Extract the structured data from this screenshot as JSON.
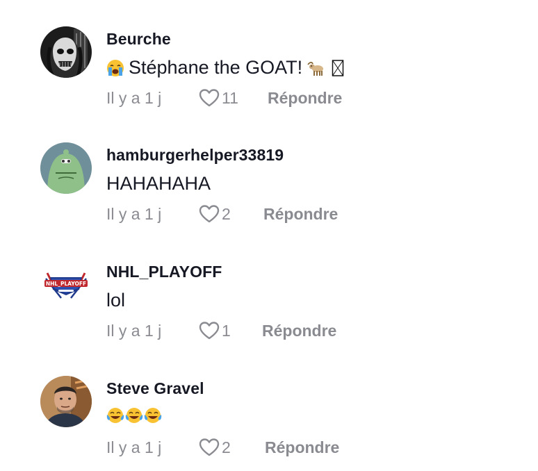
{
  "comments": [
    {
      "username": "Beurche",
      "text": "Stéphane the GOAT!",
      "timestamp": "Il y a 1 j",
      "likes": "11",
      "reply_label": "Répondre",
      "emojis_before": [
        "loudly-crying-face-emoji"
      ],
      "emojis_after": [
        "goat-emoji",
        "missing-glyph"
      ]
    },
    {
      "username": "hamburgerhelper33819",
      "text": "HAHAHAHA",
      "timestamp": "Il y a 1 j",
      "likes": "2",
      "reply_label": "Répondre"
    },
    {
      "username": "NHL_PLAYOFF",
      "text": "lol",
      "timestamp": "Il y a 1 j",
      "likes": "1",
      "reply_label": "Répondre",
      "avatar_logo_text": "NHL_PLAYOFF"
    },
    {
      "username": "Steve Gravel",
      "text": "",
      "timestamp": "Il y a 1 j",
      "likes": "2",
      "reply_label": "Répondre",
      "emojis_only": [
        "tears-of-joy-emoji",
        "tears-of-joy-emoji",
        "tears-of-joy-emoji"
      ]
    }
  ],
  "colors": {
    "text": "#161823",
    "meta": "#8a8b91",
    "background": "#ffffff"
  }
}
